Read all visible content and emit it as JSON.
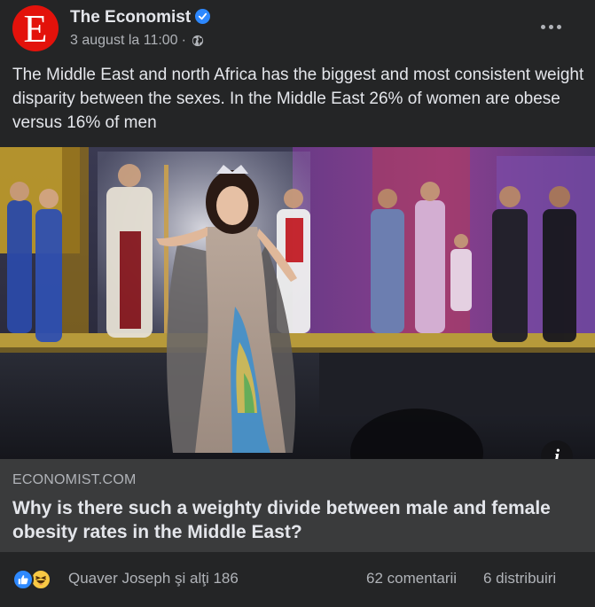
{
  "post": {
    "page_name": "The Economist",
    "avatar_letter": "E",
    "date": "3 august la 11:00",
    "separator": "·",
    "body": "The Middle East and north Africa has the biggest and most consistent weight disparity between the sexes. In the Middle East 26% of women are obese versus 16% of men"
  },
  "link": {
    "domain": "ECONOMIST.COM",
    "headline": "Why is there such a weighty divide between male and female obesity rates in the Middle East?"
  },
  "engagement": {
    "reactors": "Quaver Joseph şi alţi 186",
    "comments": "62 comentarii",
    "shares": "6 distribuiri"
  },
  "colors": {
    "brand_red": "#e3120b",
    "verified_blue": "#2d88ff",
    "like_blue": "#2e89ff",
    "haha_yellow": "#f7c844"
  },
  "icons": {
    "verified": "verified-badge-icon",
    "privacy": "globe-icon",
    "more": "more-options-icon",
    "info": "info-icon",
    "like": "like-reaction-icon",
    "haha": "haha-reaction-icon"
  }
}
